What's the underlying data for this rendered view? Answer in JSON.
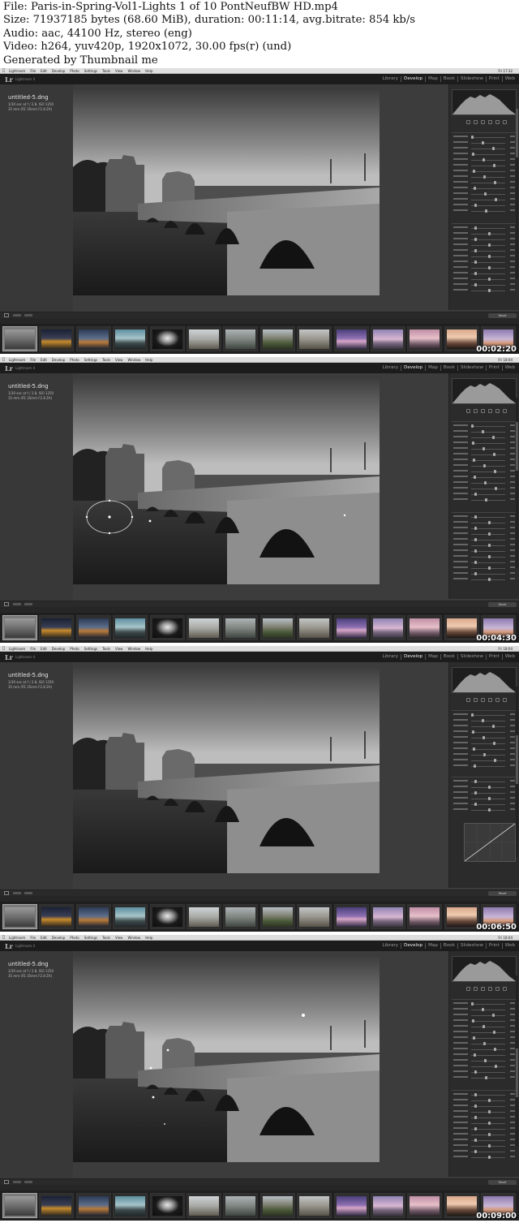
{
  "metadata": {
    "lines": [
      "File: Paris-in-Spring-Vol1-Lights 1 of 10 PontNeufBW HD.mp4",
      "Size: 71937185 bytes (68.60 MiB), duration: 00:11:14, avg.bitrate: 854 kb/s",
      "Audio: aac, 44100 Hz, stereo (eng)",
      "Video: h264, yuv420p, 1920x1072, 30.00 fps(r) (und)",
      "Generated by Thumbnail me"
    ]
  },
  "app": {
    "logo": "Lr",
    "name": "Lightroom 4",
    "menus": [
      "Lightroom",
      "File",
      "Edit",
      "Develop",
      "Photo",
      "Settings",
      "Tools",
      "View",
      "Window",
      "Help"
    ],
    "modules": [
      "Library",
      "Develop",
      "Map",
      "Book",
      "Slideshow",
      "Print",
      "Web"
    ],
    "active_module": "Develop"
  },
  "photo": {
    "filename": "untitled-5.dng",
    "exif": [
      "1/30 sec at f / 2.8, ISO 1250",
      "35 mm (FE 35mm F2.8 ZA)"
    ]
  },
  "frames": [
    {
      "timestamp": "00:02:20",
      "clock": "Fri 17:32",
      "selected_thumb": 0,
      "show_curve": false,
      "masks": []
    },
    {
      "timestamp": "00:04:30",
      "clock": "Fri 18:04",
      "selected_thumb": 0,
      "show_curve": false,
      "masks": [
        "ellipse"
      ]
    },
    {
      "timestamp": "00:06:50",
      "clock": "Fri 18:04",
      "selected_thumb": 0,
      "show_curve": true,
      "masks": []
    },
    {
      "timestamp": "00:09:00",
      "clock": "Fri 18:04",
      "selected_thumb": 0,
      "show_curve": false,
      "masks": [
        "pins"
      ]
    }
  ],
  "thumbnails": [
    {
      "tone": "bw"
    },
    {
      "tone": "gold-night"
    },
    {
      "tone": "dusk-blue"
    },
    {
      "tone": "teal-sky"
    },
    {
      "tone": "dark-arch"
    },
    {
      "tone": "pale-bridge"
    },
    {
      "tone": "grey-river"
    },
    {
      "tone": "cathedral"
    },
    {
      "tone": "stone-bridge"
    },
    {
      "tone": "purple-dusk"
    },
    {
      "tone": "pink-dusk"
    },
    {
      "tone": "rose-sky"
    },
    {
      "tone": "silhouette"
    },
    {
      "tone": "lamp-post"
    }
  ],
  "toolbar": {
    "sync_label": "Reset"
  },
  "colors": {
    "background": "#3c3c3c",
    "panel": "#2b2b2b",
    "filmstrip": "#1f1f1f",
    "active_module": "#eeeeee"
  }
}
